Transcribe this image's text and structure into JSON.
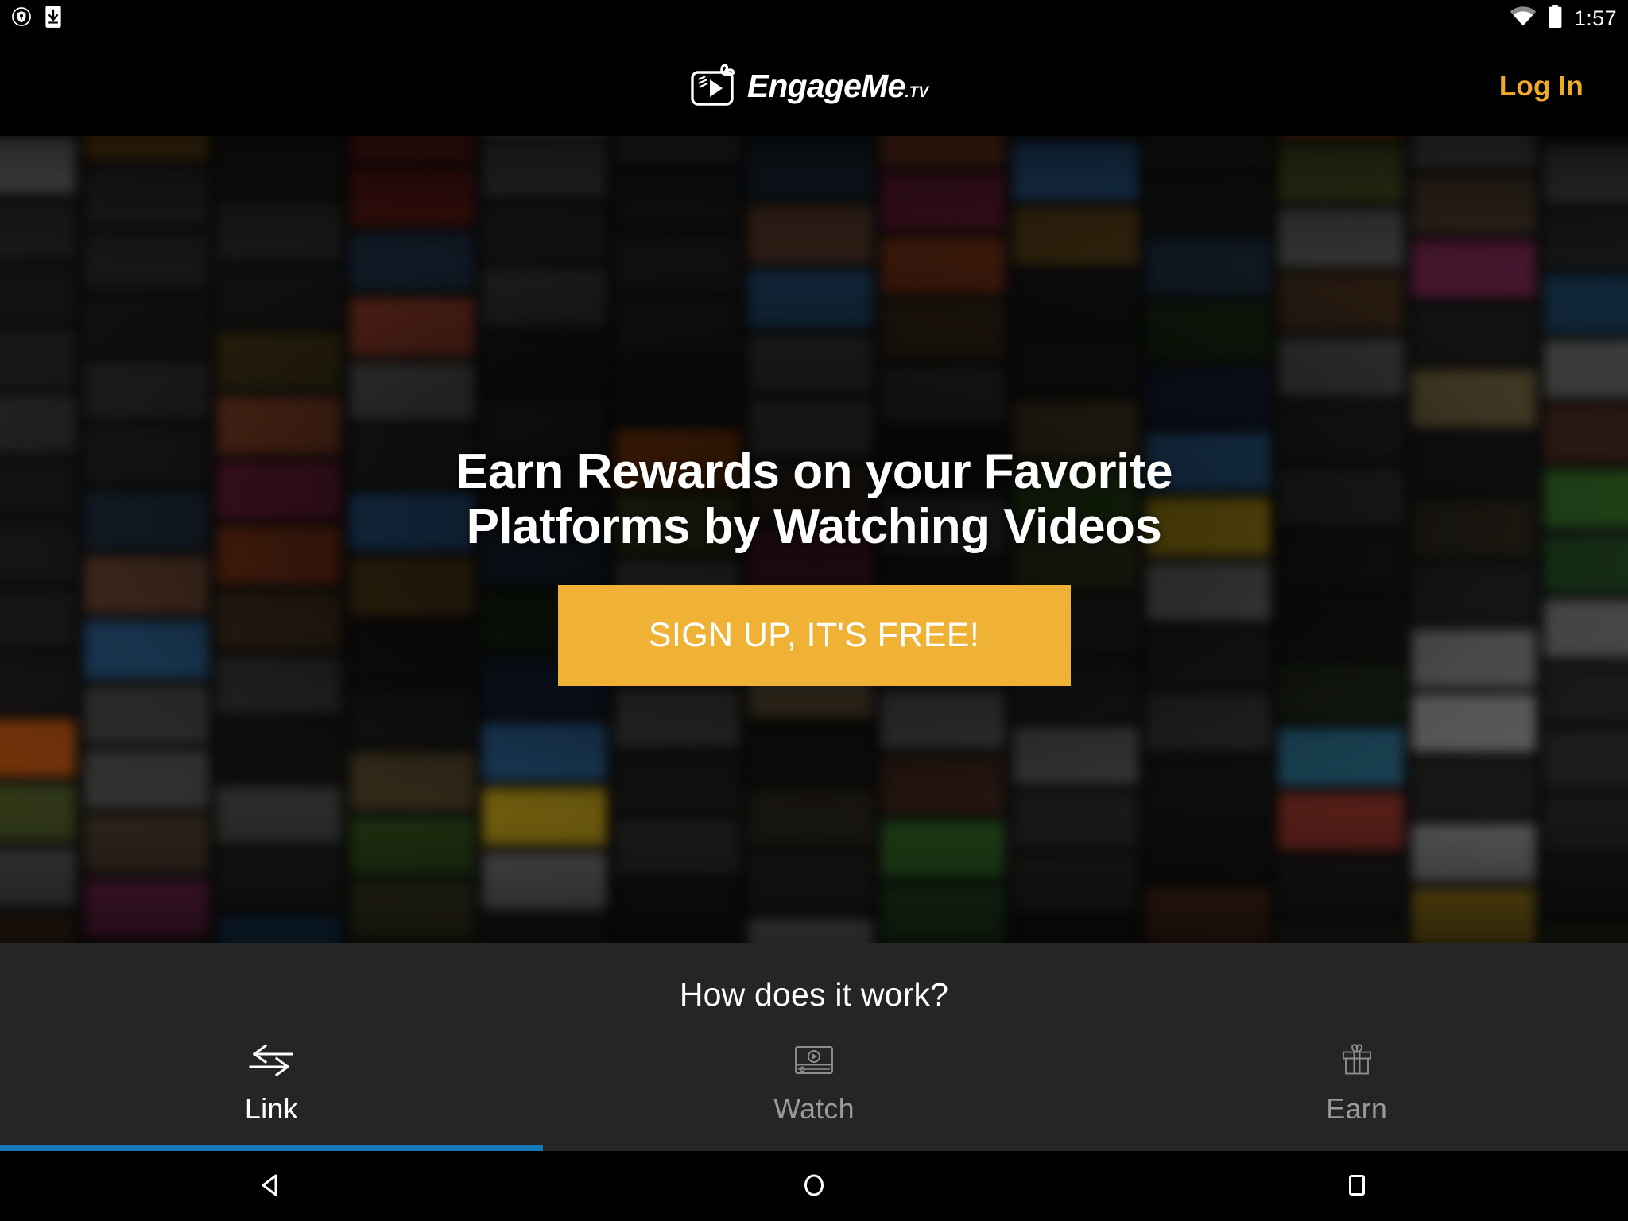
{
  "status_bar": {
    "time": "1:57",
    "left_icons": [
      "shield-key-icon",
      "device-download-icon"
    ],
    "right_icons": [
      "wifi-icon",
      "battery-full-icon"
    ]
  },
  "app_bar": {
    "brand_name": "EngageMe",
    "brand_tld": ".TV",
    "logo_icon": "tv-gift-play-logo-icon",
    "login_label": "Log In",
    "login_color": "#F0AA26"
  },
  "hero": {
    "headline": "Earn Rewards on your Favorite Platforms by Watching Videos",
    "cta_label": "SIGN UP, IT'S FREE!",
    "cta_color": "#EFB235",
    "background": "blurred-video-thumbnail-wall"
  },
  "how_section": {
    "title": "How does it work?",
    "background_color": "#252525",
    "active_indicator_color": "#1778B8",
    "tabs": [
      {
        "label": "Link",
        "icon": "swap-arrows-icon",
        "active": true
      },
      {
        "label": "Watch",
        "icon": "video-player-icon",
        "active": false
      },
      {
        "label": "Earn",
        "icon": "gift-box-icon",
        "active": false
      }
    ]
  },
  "nav_bar": {
    "buttons": [
      {
        "name": "back",
        "icon": "back-triangle-icon"
      },
      {
        "name": "home",
        "icon": "home-circle-icon"
      },
      {
        "name": "recents",
        "icon": "recents-square-icon"
      }
    ]
  },
  "video_wall_colors": [
    [
      "#2f3a22",
      "#5b4a2a",
      "#141414",
      "#1d4a6e",
      "#6e2018",
      "#3a3422",
      "#1c1c1c",
      "#2a3c1e",
      "#233a52",
      "#4a2a1c",
      "#2b2b2b",
      "#512a18",
      "#1a2a3a"
    ],
    [
      "#1a2f14",
      "#0e0e12",
      "#3c6a1e",
      "#56503a",
      "#9a9a98",
      "#7d1e16",
      "#222222",
      "#5c4a16",
      "#2a6e8c",
      "#5a3a2a",
      "#8e8e8c",
      "#b8520e",
      "#3a3a3a"
    ],
    [
      "#2c4a62",
      "#1c2a4e",
      "#9c9c9a",
      "#6e6a3a",
      "#1a1a1a",
      "#42261c",
      "#2a4a72",
      "#8a8a88",
      "#7a3a22",
      "#b03a2e",
      "#2a5e8e",
      "#cfd2d4",
      "#5a6a2a"
    ],
    [
      "#8c8c8a",
      "#2a2a28",
      "#2a5e8e",
      "#3a3a36",
      "#2a2a2a",
      "#c9cbc9",
      "#3a7a2a",
      "#8e3a26",
      "#c8c8c6",
      "#7a1e3a",
      "#2a2a2a",
      "#5a5a58",
      "#9a3a26"
    ],
    [
      "#3a5a22",
      "#3e2a1a",
      "#c27a18",
      "#d4b018",
      "#1a1a1a",
      "#2a2a2a",
      "#4a4a48",
      "#2e6a2e",
      "#6e6e6c",
      "#3a3a38",
      "#b8451a",
      "#2a2a2a",
      "#8a8a88"
    ],
    [
      "#4a3a2a",
      "#b6b6b4",
      "#5a5a58",
      "#2a2a28",
      "#a8a8a6",
      "#2a2a2a",
      "#9a9a98",
      "#2a2a2a",
      "#6a6a68",
      "#3a3a38",
      "#8a8a88",
      "#3a2a1a",
      "#6a6a68"
    ],
    [
      "#2a3a6e",
      "#8e2a5a",
      "#3a5a2a",
      "#2a2a28",
      "#2a2a2a",
      "#3a3a38",
      "#4a4a48",
      "#2a2a2a",
      "#5a5a58",
      "#2a2a28",
      "#2a5a8e",
      "#c8a020",
      "#3a3a38"
    ],
    [
      "#1a1a1a",
      "#5a1a3a",
      "#2a2a28",
      "#1a1a1a",
      "#2a2a2a",
      "#222222",
      "#3a3a38",
      "#1a1a1a",
      "#2a2a28",
      "#1a1a1a",
      "#3a3a38",
      "#6a4a1a",
      "#2a2a28"
    ],
    [
      "#2a2a28",
      "#7a7a78",
      "#1a1a1a",
      "#6a5a3a",
      "#2a2a2a",
      "#1a1a1a",
      "#2a2a28",
      "#1a1a1a",
      "#222222",
      "#1a1a1a",
      "#2a2a28",
      "#3a3a38",
      "#1a1a1a"
    ],
    [
      "#1a1a1a",
      "#4a3a1a",
      "#222222",
      "#3a3a38",
      "#1a1a1a",
      "#2a2a28",
      "#1a1a1a",
      "#222222",
      "#1a1a1a",
      "#2a2a28",
      "#1a1a1a",
      "#222222",
      "#1a1a1a"
    ]
  ]
}
